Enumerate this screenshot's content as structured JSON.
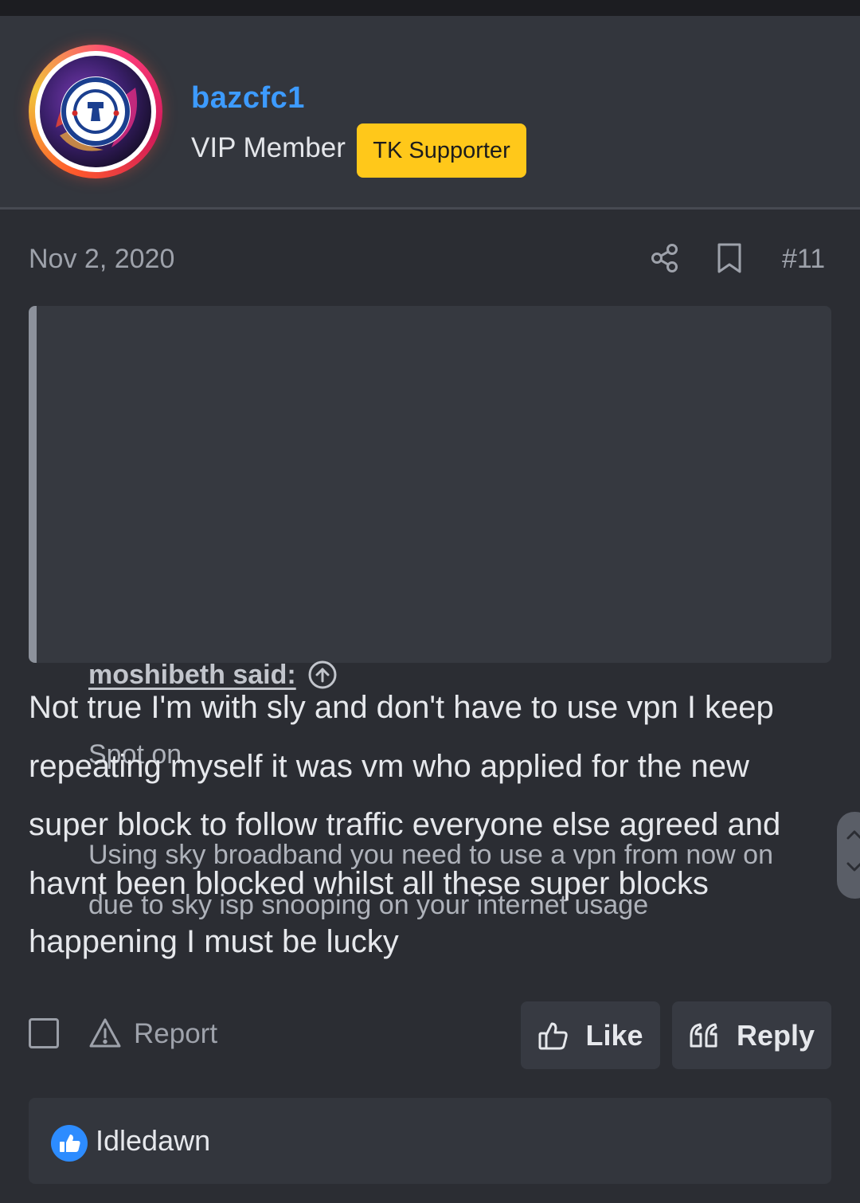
{
  "user": {
    "username": "bazcfc1",
    "title": "VIP Member",
    "badge": "TK Supporter",
    "avatar_icon": "chelsea-crest-avatar"
  },
  "post": {
    "date": "Nov 2, 2020",
    "number": "#11",
    "quote": {
      "author": "moshibeth said:",
      "line1": "Spot on",
      "line2": "Using sky broadband you need to use a vpn from now on due to sky isp snooping on your internet usage"
    },
    "body": "Not true I'm with sly and don't have to use vpn I keep repeating myself it was vm who applied for the new super block to follow traffic everyone else agreed and havnt been blocked whilst all these super blocks happening I must be lucky"
  },
  "actions": {
    "report_label": "Report",
    "like_label": "Like",
    "reply_label": "Reply"
  },
  "reactions": {
    "users": "Idledawn"
  },
  "colors": {
    "background": "#2b2d33",
    "header": "#33363d",
    "username": "#3d9bff",
    "badge": "#ffc81a",
    "reaction_like": "#2d8cff"
  }
}
